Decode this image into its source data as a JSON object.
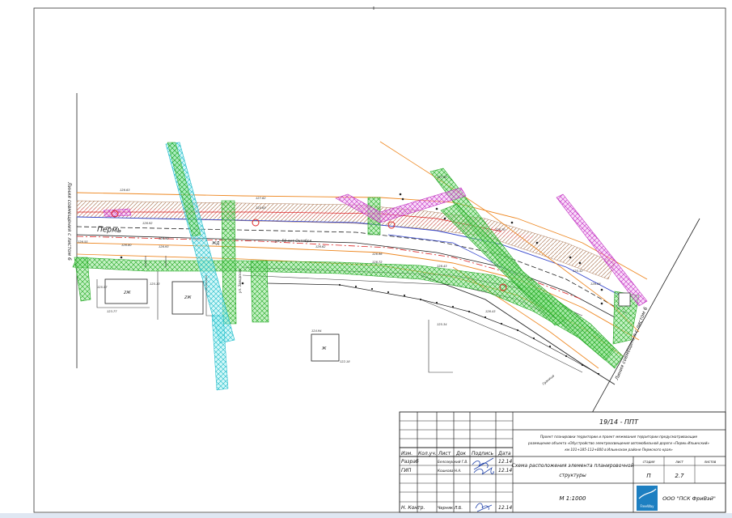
{
  "drawing": {
    "street_label": "Пермь",
    "street_label_2": "ул. 50 лет Октября",
    "street_label_3": "ул. Заводская",
    "match_line_left": "Линия совмещения с листом 6",
    "match_line_right": "Линия совмещения с листом 6",
    "building_labels": [
      "2Ж",
      "2Ж",
      "Ж"
    ],
    "elevations": [
      "126.63",
      "127.62",
      "125.63",
      "126.92",
      "126.90",
      "126.93",
      "126.55",
      "126.80",
      "126.62",
      "125.57",
      "125.13",
      "126.96",
      "126.72",
      "123.77",
      "122.18",
      "124.94",
      "125.34",
      "127.90",
      "126.70",
      "125.32",
      "126.43",
      "126.08",
      "126.43"
    ],
    "road_note": "ЖД",
    "side_note": "Граница"
  },
  "title_block": {
    "doc_code": "19/14 - ППТ",
    "project_title_1": "Проект планировки территории и проект межевания территории предусматривающие",
    "project_title_2": "размещение объекта «Обустройство электроосвещения автомобильной дороги «Пермь-Ильинский»",
    "project_title_3": "км 101+185-112+000 в Ильинском районе Пермского края»",
    "headers": [
      "Изм.",
      "Кол.уч.",
      "Лист",
      "Док",
      "Подпись",
      "Дата"
    ],
    "rows": [
      {
        "role": "Разраб",
        "name": "Белозерский Г.В.",
        "date": "12.14"
      },
      {
        "role": "ГИП",
        "name": "Кошкова Н.А.",
        "date": "12.14"
      },
      {
        "role": "Н. Контр.",
        "name": "Черняк Л.Б.",
        "date": "12.14"
      }
    ],
    "sheet_title_1": "Схема расположения элемента планировочной",
    "sheet_title_2": "структуры",
    "scale": "М 1:1000",
    "stage_header": "стадия",
    "sheet_header": "лист",
    "sheets_header": "листов",
    "stage_value": "П",
    "sheet_value": "2.7",
    "sheets_value": "",
    "company": "ООО \"ПСК ФриВэй\"",
    "logo_text": "FreeWay"
  },
  "colors": {
    "green_hatch": "#33cc33",
    "cyan_hatch": "#22cccc",
    "magenta_hatch": "#cc33cc",
    "orange_line": "#ee8822",
    "red_line": "#dd2222",
    "brown_hatch": "#b08060",
    "blue_line": "#3344cc",
    "logo_blue": "#1d7fc1"
  }
}
